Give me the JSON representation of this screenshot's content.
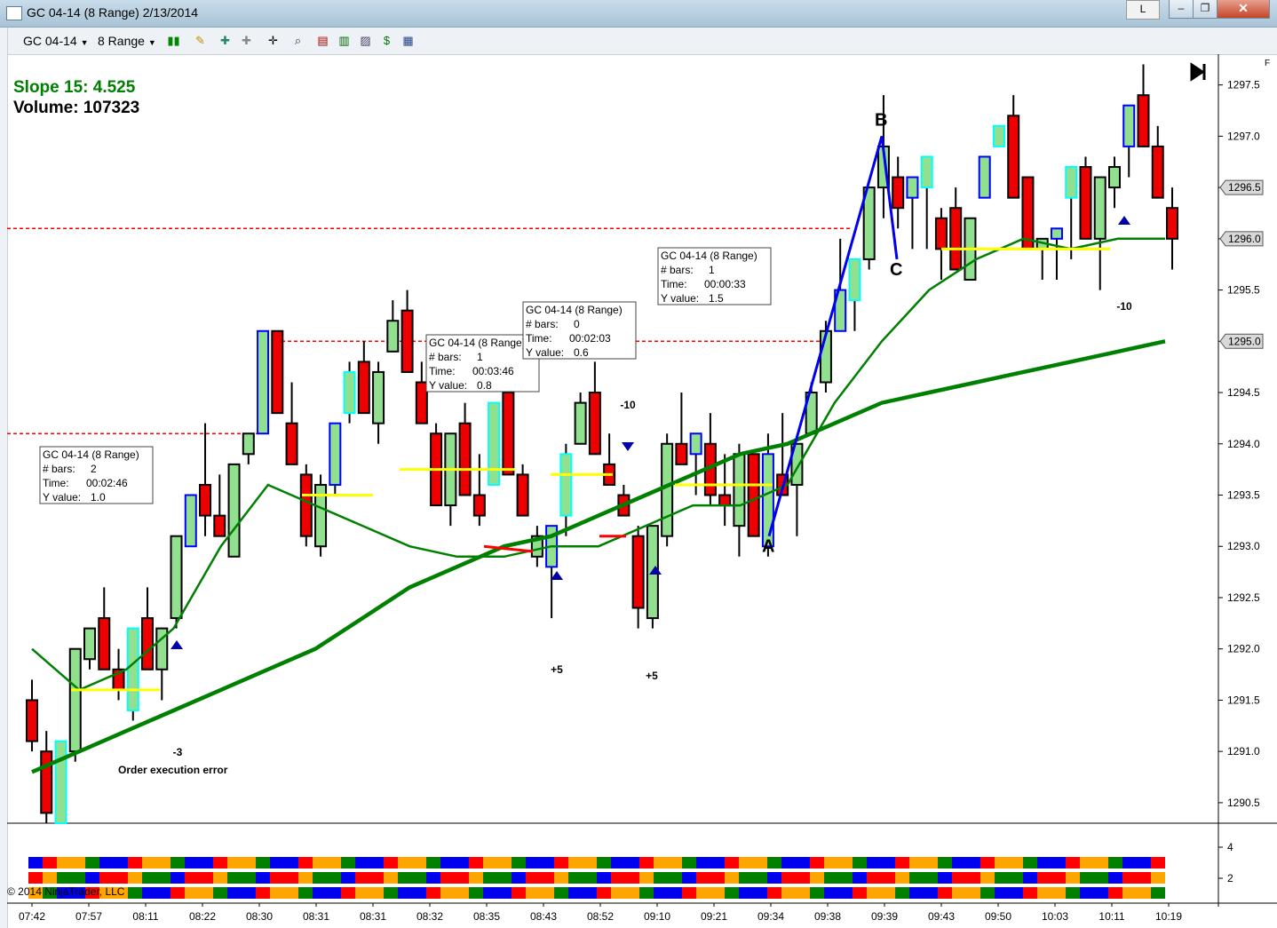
{
  "window": {
    "title": "GC 04-14 (8 Range)  2/13/2014",
    "l_button": "L",
    "minimize": "–",
    "maximize": "❐",
    "close": "✕"
  },
  "toolbar": {
    "instrument": "GC 04-14",
    "interval": "8 Range",
    "icons": [
      "bar-style-icon",
      "pencil-icon",
      "draw-tools-icon",
      "crosshair-icon",
      "zoom-icon",
      "data-box-icon",
      "indicators-icon",
      "strategy-icon",
      "chart-trader-icon",
      "properties-icon"
    ]
  },
  "overlay": {
    "slope_label": "Slope 15: 4.525",
    "volume_label": "Volume: 107323",
    "f_label": "F",
    "copyright": "© 2014 NinjaTrader, LLC"
  },
  "colors": {
    "up": "#90e090",
    "down": "#ee0000",
    "sma": "#008000",
    "trend_yellow": "#ffff00",
    "trend_red": "#ff0000",
    "zigzag": "#0000ee",
    "hline": "#ff0000"
  },
  "chart_data": {
    "type": "candlestick",
    "y_axis": {
      "range": [
        1290.3,
        1297.8
      ],
      "ticks": [
        "1297.5",
        "1297.0",
        "1296.5",
        "1296.0",
        "1295.5",
        "1295.0",
        "1294.5",
        "1294.0",
        "1293.5",
        "1293.0",
        "1292.5",
        "1292.0",
        "1291.5",
        "1291.0",
        "1290.5"
      ],
      "price_badges": [
        "1296.5",
        "1296.0",
        "1295.0"
      ]
    },
    "x_axis": {
      "ticks": [
        "07:42",
        "07:57",
        "08:11",
        "08:22",
        "08:30",
        "08:31",
        "08:31",
        "08:32",
        "08:35",
        "08:43",
        "08:52",
        "09:10",
        "09:21",
        "09:34",
        "09:38",
        "09:39",
        "09:43",
        "09:50",
        "10:03",
        "10:11",
        "10:19"
      ]
    },
    "candles": [
      {
        "o": 1291.5,
        "h": 1291.7,
        "l": 1291.0,
        "c": 1291.1
      },
      {
        "o": 1291.0,
        "h": 1291.2,
        "l": 1290.3,
        "c": 1290.4
      },
      {
        "o": 1290.3,
        "h": 1291.1,
        "l": 1290.3,
        "c": 1291.1
      },
      {
        "o": 1291.0,
        "h": 1292.0,
        "l": 1290.9,
        "c": 1292.0
      },
      {
        "o": 1291.9,
        "h": 1292.2,
        "l": 1291.8,
        "c": 1292.2
      },
      {
        "o": 1292.3,
        "h": 1292.6,
        "l": 1291.8,
        "c": 1291.8
      },
      {
        "o": 1291.8,
        "h": 1292.0,
        "l": 1291.5,
        "c": 1291.6
      },
      {
        "o": 1291.4,
        "h": 1292.2,
        "l": 1291.3,
        "c": 1292.2
      },
      {
        "o": 1292.3,
        "h": 1292.6,
        "l": 1291.8,
        "c": 1291.8
      },
      {
        "o": 1291.8,
        "h": 1292.2,
        "l": 1291.5,
        "c": 1292.2
      },
      {
        "o": 1292.3,
        "h": 1293.1,
        "l": 1292.2,
        "c": 1293.1
      },
      {
        "o": 1293.0,
        "h": 1293.5,
        "l": 1293.0,
        "c": 1293.5
      },
      {
        "o": 1293.6,
        "h": 1294.2,
        "l": 1293.1,
        "c": 1293.3
      },
      {
        "o": 1293.3,
        "h": 1293.7,
        "l": 1293.1,
        "c": 1293.1
      },
      {
        "o": 1292.9,
        "h": 1293.8,
        "l": 1292.9,
        "c": 1293.8
      },
      {
        "o": 1293.9,
        "h": 1294.1,
        "l": 1293.8,
        "c": 1294.1
      },
      {
        "o": 1294.1,
        "h": 1295.1,
        "l": 1294.1,
        "c": 1295.1
      },
      {
        "o": 1295.1,
        "h": 1295.1,
        "l": 1294.3,
        "c": 1294.3
      },
      {
        "o": 1294.2,
        "h": 1294.6,
        "l": 1293.8,
        "c": 1293.8
      },
      {
        "o": 1293.7,
        "h": 1293.8,
        "l": 1293.0,
        "c": 1293.1
      },
      {
        "o": 1293.0,
        "h": 1293.7,
        "l": 1292.9,
        "c": 1293.6
      },
      {
        "o": 1293.6,
        "h": 1294.2,
        "l": 1293.5,
        "c": 1294.2
      },
      {
        "o": 1294.3,
        "h": 1294.8,
        "l": 1294.2,
        "c": 1294.7
      },
      {
        "o": 1294.8,
        "h": 1295.0,
        "l": 1294.3,
        "c": 1294.3
      },
      {
        "o": 1294.2,
        "h": 1294.8,
        "l": 1294.0,
        "c": 1294.7
      },
      {
        "o": 1294.9,
        "h": 1295.4,
        "l": 1294.9,
        "c": 1295.2
      },
      {
        "o": 1295.3,
        "h": 1295.5,
        "l": 1294.7,
        "c": 1294.7
      },
      {
        "o": 1294.6,
        "h": 1294.8,
        "l": 1294.2,
        "c": 1294.2
      },
      {
        "o": 1294.1,
        "h": 1294.2,
        "l": 1293.4,
        "c": 1293.4
      },
      {
        "o": 1293.4,
        "h": 1294.1,
        "l": 1293.2,
        "c": 1294.1
      },
      {
        "o": 1294.2,
        "h": 1294.4,
        "l": 1293.5,
        "c": 1293.5
      },
      {
        "o": 1293.5,
        "h": 1293.9,
        "l": 1293.2,
        "c": 1293.3
      },
      {
        "o": 1293.6,
        "h": 1294.4,
        "l": 1293.6,
        "c": 1294.4
      },
      {
        "o": 1294.5,
        "h": 1294.5,
        "l": 1293.7,
        "c": 1293.7
      },
      {
        "o": 1293.7,
        "h": 1293.8,
        "l": 1293.3,
        "c": 1293.3
      },
      {
        "o": 1292.9,
        "h": 1293.2,
        "l": 1292.8,
        "c": 1293.1
      },
      {
        "o": 1292.8,
        "h": 1293.2,
        "l": 1292.3,
        "c": 1293.2
      },
      {
        "o": 1293.3,
        "h": 1294.0,
        "l": 1293.1,
        "c": 1293.9
      },
      {
        "o": 1294.0,
        "h": 1294.5,
        "l": 1294.0,
        "c": 1294.4
      },
      {
        "o": 1294.5,
        "h": 1294.8,
        "l": 1293.9,
        "c": 1293.9
      },
      {
        "o": 1293.8,
        "h": 1294.1,
        "l": 1293.6,
        "c": 1293.6
      },
      {
        "o": 1293.5,
        "h": 1293.6,
        "l": 1293.3,
        "c": 1293.3
      },
      {
        "o": 1293.1,
        "h": 1293.2,
        "l": 1292.2,
        "c": 1292.4
      },
      {
        "o": 1292.3,
        "h": 1293.2,
        "l": 1292.2,
        "c": 1293.2
      },
      {
        "o": 1293.1,
        "h": 1294.1,
        "l": 1293.0,
        "c": 1294.0
      },
      {
        "o": 1294.0,
        "h": 1294.5,
        "l": 1293.8,
        "c": 1293.8
      },
      {
        "o": 1293.9,
        "h": 1294.1,
        "l": 1293.5,
        "c": 1294.1
      },
      {
        "o": 1294.0,
        "h": 1294.3,
        "l": 1293.4,
        "c": 1293.5
      },
      {
        "o": 1293.5,
        "h": 1293.9,
        "l": 1293.2,
        "c": 1293.4
      },
      {
        "o": 1293.2,
        "h": 1294.0,
        "l": 1292.9,
        "c": 1293.9
      },
      {
        "o": 1293.9,
        "h": 1293.9,
        "l": 1293.1,
        "c": 1293.1
      },
      {
        "o": 1293.0,
        "h": 1294.1,
        "l": 1292.9,
        "c": 1293.9
      },
      {
        "o": 1293.7,
        "h": 1294.3,
        "l": 1293.5,
        "c": 1293.5
      },
      {
        "o": 1293.6,
        "h": 1294.0,
        "l": 1293.1,
        "c": 1294.0
      },
      {
        "o": 1294.1,
        "h": 1294.6,
        "l": 1294.1,
        "c": 1294.5
      },
      {
        "o": 1294.6,
        "h": 1295.2,
        "l": 1294.5,
        "c": 1295.1
      },
      {
        "o": 1295.1,
        "h": 1296.0,
        "l": 1295.1,
        "c": 1295.5
      },
      {
        "o": 1295.4,
        "h": 1295.8,
        "l": 1295.1,
        "c": 1295.8
      },
      {
        "o": 1295.8,
        "h": 1296.5,
        "l": 1295.7,
        "c": 1296.5
      },
      {
        "o": 1296.5,
        "h": 1297.4,
        "l": 1296.2,
        "c": 1296.9
      },
      {
        "o": 1296.6,
        "h": 1296.8,
        "l": 1296.1,
        "c": 1296.3
      },
      {
        "o": 1296.4,
        "h": 1296.6,
        "l": 1295.9,
        "c": 1296.6
      },
      {
        "o": 1296.5,
        "h": 1296.8,
        "l": 1295.9,
        "c": 1296.8
      },
      {
        "o": 1296.2,
        "h": 1296.3,
        "l": 1295.6,
        "c": 1295.9
      },
      {
        "o": 1296.3,
        "h": 1296.5,
        "l": 1295.7,
        "c": 1295.7
      },
      {
        "o": 1295.6,
        "h": 1296.2,
        "l": 1295.6,
        "c": 1296.2
      },
      {
        "o": 1296.4,
        "h": 1296.8,
        "l": 1296.4,
        "c": 1296.8
      },
      {
        "o": 1296.9,
        "h": 1297.1,
        "l": 1296.9,
        "c": 1297.1
      },
      {
        "o": 1297.2,
        "h": 1297.4,
        "l": 1296.4,
        "c": 1296.4
      },
      {
        "o": 1296.6,
        "h": 1296.6,
        "l": 1295.9,
        "c": 1295.9
      },
      {
        "o": 1295.9,
        "h": 1296.0,
        "l": 1295.6,
        "c": 1296.0
      },
      {
        "o": 1296.0,
        "h": 1296.1,
        "l": 1295.6,
        "c": 1296.1
      },
      {
        "o": 1296.4,
        "h": 1296.7,
        "l": 1295.8,
        "c": 1296.7
      },
      {
        "o": 1296.7,
        "h": 1296.8,
        "l": 1296.0,
        "c": 1296.0
      },
      {
        "o": 1296.0,
        "h": 1296.6,
        "l": 1295.5,
        "c": 1296.6
      },
      {
        "o": 1296.5,
        "h": 1296.8,
        "l": 1296.3,
        "c": 1296.7
      },
      {
        "o": 1296.9,
        "h": 1297.3,
        "l": 1296.6,
        "c": 1297.3
      },
      {
        "o": 1297.4,
        "h": 1297.7,
        "l": 1296.9,
        "c": 1296.9
      },
      {
        "o": 1296.9,
        "h": 1297.1,
        "l": 1296.4,
        "c": 1296.4
      },
      {
        "o": 1296.3,
        "h": 1296.5,
        "l": 1295.7,
        "c": 1296.0
      }
    ],
    "sma_slow": [
      1290.8,
      1291.0,
      1291.2,
      1291.4,
      1291.6,
      1291.8,
      1292.0,
      1292.3,
      1292.6,
      1292.8,
      1293.0,
      1293.1,
      1293.3,
      1293.5,
      1293.7,
      1293.9,
      1294.0,
      1294.2,
      1294.4,
      1294.5,
      1294.6,
      1294.7,
      1294.8,
      1294.9,
      1295.0
    ],
    "sma_fast": [
      1292.0,
      1291.6,
      1291.8,
      1292.2,
      1293.0,
      1293.6,
      1293.4,
      1293.2,
      1293.0,
      1292.9,
      1292.9,
      1293.0,
      1293.0,
      1293.2,
      1293.4,
      1293.4,
      1293.6,
      1294.4,
      1295.0,
      1295.5,
      1295.8,
      1296.0,
      1295.9,
      1296.0,
      1296.0
    ],
    "zigzag": [
      {
        "label": "A",
        "price": 1293.1
      },
      {
        "label": "B",
        "price": 1297.0
      },
      {
        "label": "C",
        "price": 1295.8
      }
    ],
    "hlines": [
      1296.1,
      1295.0,
      1294.1
    ],
    "annotations": [
      "-3",
      "Order execution error",
      "+5",
      "+5",
      "-10",
      "-10"
    ],
    "stat_boxes": [
      {
        "title": "GC 04-14 (8 Range)",
        "bars_label": "# bars:",
        "bars": "2",
        "time_label": "Time:",
        "time": "00:02:46",
        "yv_label": "Y value:",
        "yv": "1.0"
      },
      {
        "title": "GC 04-14 (8 Range)",
        "bars_label": "# bars:",
        "bars": "1",
        "time_label": "Time:",
        "time": "00:03:46",
        "yv_label": "Y value:",
        "yv": "0.8"
      },
      {
        "title": "GC 04-14 (8 Range)",
        "bars_label": "# bars:",
        "bars": "0",
        "time_label": "Time:",
        "time": "00:02:03",
        "yv_label": "Y value:",
        "yv": "0.6"
      },
      {
        "title": "GC 04-14 (8 Range)",
        "bars_label": "# bars:",
        "bars": "1",
        "time_label": "Time:",
        "time": "00:00:33",
        "yv_label": "Y value:",
        "yv": "1.5"
      }
    ],
    "lower_panel": {
      "ticks": [
        "4",
        "2"
      ],
      "rows": 3,
      "palette": [
        "#0000ee",
        "#008000",
        "#ffa500",
        "#ff0000"
      ]
    }
  }
}
